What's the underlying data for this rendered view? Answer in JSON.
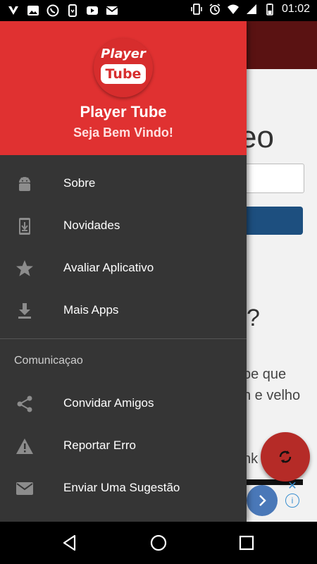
{
  "status_bar": {
    "time": "01:02",
    "left_icons": [
      "app-notification-icon",
      "image-icon",
      "whatsapp-icon",
      "sim-toolkit-icon",
      "youtube-icon",
      "gmail-icon"
    ],
    "right_icons": [
      "vibrate-icon",
      "alarm-icon",
      "wifi-icon",
      "signal-icon",
      "battery-icon"
    ]
  },
  "drawer": {
    "logo": {
      "top": "Player",
      "bottom": "Tube"
    },
    "app_name": "Player Tube",
    "welcome": "Seja Bem Vindo!",
    "items": [
      {
        "label": "Sobre",
        "icon": "android-icon"
      },
      {
        "label": "Novidades",
        "icon": "download-phone-icon"
      },
      {
        "label": "Avaliar Aplicativo",
        "icon": "star-icon"
      },
      {
        "label": "Mais Apps",
        "icon": "download-icon"
      }
    ],
    "section_title": "Comunicaçao",
    "comm_items": [
      {
        "label": "Convidar Amigos",
        "icon": "share-icon"
      },
      {
        "label": "Reportar Erro",
        "icon": "warning-icon"
      },
      {
        "label": "Enviar Uma Sugestão",
        "icon": "mail-icon"
      }
    ]
  },
  "background": {
    "big_text": "eo",
    "question": "?",
    "line1": "be que",
    "line2": "n e velho",
    "line3": "nk"
  },
  "colors": {
    "header_red": "#e03131",
    "drawer_bg": "#353535",
    "fab_red": "#b52b27",
    "button_blue": "#1d4f7f"
  }
}
